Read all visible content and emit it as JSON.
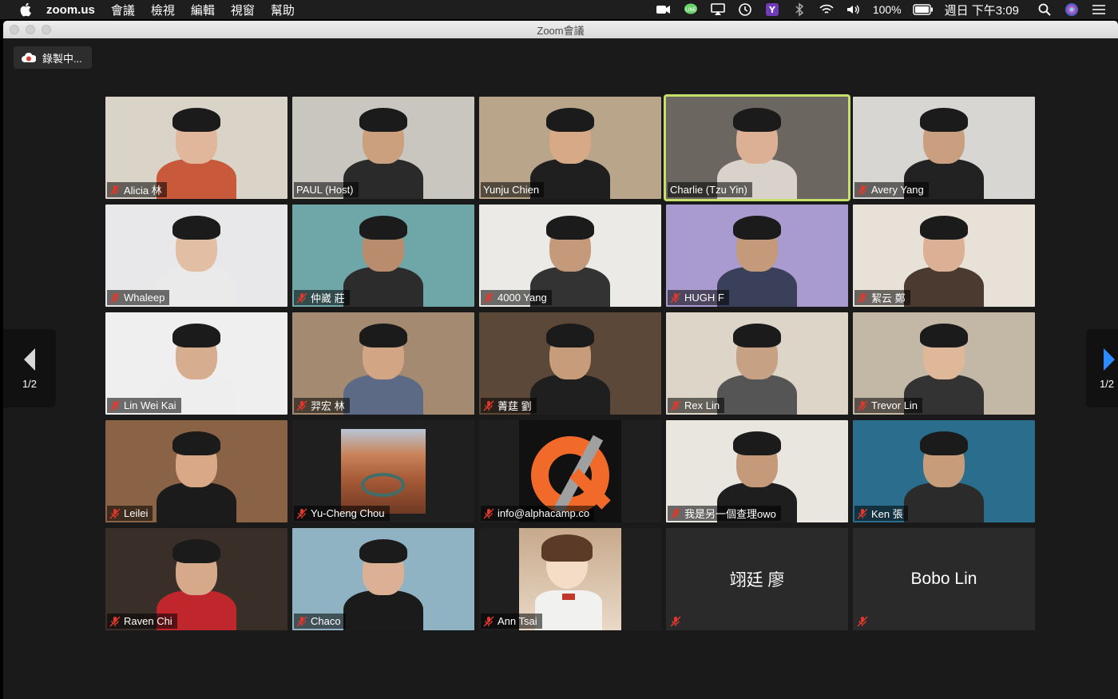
{
  "menubar": {
    "app_name": "zoom.us",
    "menus": [
      "會議",
      "檢視",
      "編輯",
      "視窗",
      "幫助"
    ],
    "battery": "100%",
    "datetime": "週日 下午3:09",
    "icons": [
      "zoom-icon",
      "line-icon",
      "airplay-icon",
      "time-machine-icon",
      "yahoo-icon",
      "bluetooth-icon",
      "wifi-icon",
      "volume-icon",
      "battery-icon",
      "search-icon",
      "siri-icon",
      "control-center-icon"
    ]
  },
  "window": {
    "title": "Zoom會議"
  },
  "recording": {
    "label": "錄製中..."
  },
  "pagination": {
    "current": "1/2",
    "right": "1/2"
  },
  "participants": [
    {
      "name": "Alicia 林",
      "muted": true,
      "bg": "#d9d3c8",
      "skin": "#e0b79a",
      "shirt": "#c85a3b"
    },
    {
      "name": "PAUL (Host)",
      "muted": false,
      "bg": "#c9c6c0",
      "skin": "#caa07f",
      "shirt": "#2a2a2a"
    },
    {
      "name": "Yunju Chien",
      "muted": false,
      "bg": "#b9a58a",
      "skin": "#d7a986",
      "shirt": "#1f1f1f"
    },
    {
      "name": "Charlie (Tzu Yin)",
      "muted": false,
      "bg": "#6b6660",
      "skin": "#dcb095",
      "shirt": "#d8d2cb",
      "active": true
    },
    {
      "name": "Avery Yang",
      "muted": true,
      "bg": "#d8d6d2",
      "skin": "#c99f80",
      "shirt": "#222"
    },
    {
      "name": "Whaleep",
      "muted": true,
      "bg": "#e8e8ea",
      "skin": "#e2bfa4",
      "shirt": "#eaeaea"
    },
    {
      "name": "仲崴 莊",
      "muted": true,
      "bg": "#6fa6a8",
      "skin": "#b88c6c",
      "shirt": "#2c2c2c"
    },
    {
      "name": "4000 Yang",
      "muted": true,
      "bg": "#eceae6",
      "skin": "#c49a7b",
      "shirt": "#333"
    },
    {
      "name": "HUGH F",
      "muted": true,
      "bg": "#a99bd0",
      "skin": "#c49a7b",
      "shirt": "#3a3f5a"
    },
    {
      "name": "絜云 鄭",
      "muted": true,
      "bg": "#e7e1d7",
      "skin": "#dcb095",
      "shirt": "#4a3a30"
    },
    {
      "name": "Lin Wei Kai",
      "muted": true,
      "bg": "#efefef",
      "skin": "#d6ad8e",
      "shirt": "#eee"
    },
    {
      "name": "羿宏 林",
      "muted": true,
      "bg": "#a38a70",
      "skin": "#d2a585",
      "shirt": "#5d6a86"
    },
    {
      "name": "菁莛 劉",
      "muted": true,
      "bg": "#5b4839",
      "skin": "#c79c7b",
      "shirt": "#1f1f1f"
    },
    {
      "name": "Rex Lin",
      "muted": true,
      "bg": "#ddd6c8",
      "skin": "#c6a184",
      "shirt": "#555"
    },
    {
      "name": "Trevor Lin",
      "muted": true,
      "bg": "#c3b7a6",
      "skin": "#dfb89a",
      "shirt": "#333"
    },
    {
      "name": "Leilei",
      "muted": true,
      "bg": "#8a6246",
      "skin": "#d9a886",
      "shirt": "#1b1b1b"
    },
    {
      "name": "Yu-Cheng Chou",
      "muted": true,
      "bg": "#1f1f1f",
      "image": "canyon"
    },
    {
      "name": "info@alphacamp.co",
      "muted": true,
      "bg": "#1f1f1f",
      "image": "alpha-logo"
    },
    {
      "name": "我是另一個查理owo",
      "muted": true,
      "bg": "#e9e5df",
      "skin": "#c59a7a",
      "shirt": "#1e1e1e"
    },
    {
      "name": "Ken 張",
      "muted": true,
      "bg": "#2a6d8c",
      "skin": "#c79c7b",
      "shirt": "#2b2b2b"
    },
    {
      "name": "Raven Chi",
      "muted": true,
      "bg": "#3a2e28",
      "skin": "#d6a98a",
      "shirt": "#c0272d"
    },
    {
      "name": "Chaco",
      "muted": true,
      "bg": "#8fb3c2",
      "skin": "#dcb095",
      "shirt": "#1b1b1b"
    },
    {
      "name": "Ann Tsai",
      "muted": true,
      "bg": "#1f1f1f",
      "image": "anime"
    },
    {
      "name": "",
      "display_name": "翊廷 廖",
      "muted": true,
      "bg": "#2a2a2a",
      "no_video": true
    },
    {
      "name": "",
      "display_name": "Bobo Lin",
      "muted": true,
      "bg": "#2a2a2a",
      "no_video": true
    }
  ]
}
